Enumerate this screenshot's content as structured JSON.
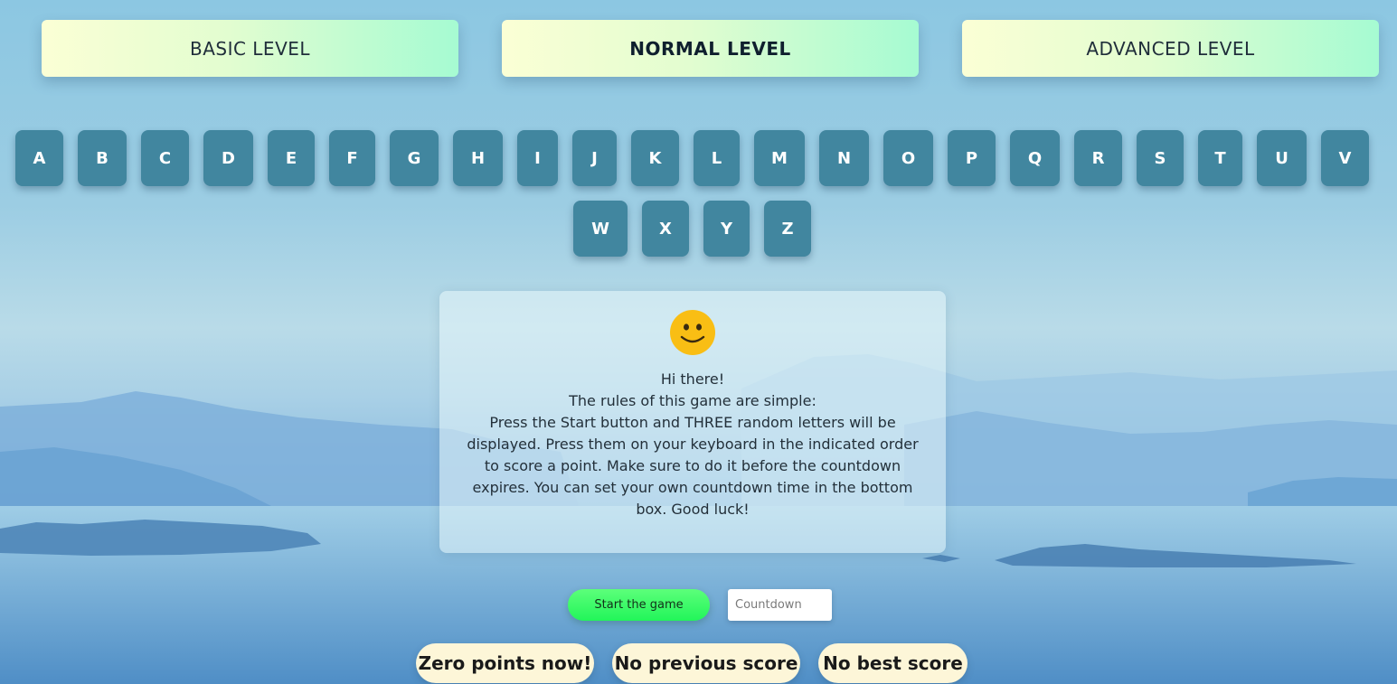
{
  "levels": [
    {
      "label": "BASIC LEVEL",
      "active": false
    },
    {
      "label": "NORMAL LEVEL",
      "active": true
    },
    {
      "label": "ADVANCED LEVEL",
      "active": false
    }
  ],
  "keyboard": {
    "letters": [
      "A",
      "B",
      "C",
      "D",
      "E",
      "F",
      "G",
      "H",
      "I",
      "J",
      "K",
      "L",
      "M",
      "N",
      "O",
      "P",
      "Q",
      "R",
      "S",
      "T",
      "U",
      "V",
      "W",
      "X",
      "Y",
      "Z"
    ]
  },
  "rules": {
    "emoji_icon": "smiley-face-icon",
    "greeting": "Hi there!",
    "intro": "The rules of this game are simple:",
    "body": "Press the Start button and THREE random letters will be displayed. Press them on your keyboard in the indicated order to score a point. Make sure to do it before the countdown expires. You can set your own countdown time in the bottom box. Good luck!"
  },
  "controls": {
    "start_label": "Start the game",
    "countdown_placeholder": "Countdown",
    "countdown_value": ""
  },
  "scores": {
    "current": "Zero points now!",
    "previous": "No previous score",
    "best": "No best score"
  },
  "colors": {
    "key_bg": "#41869f",
    "start_button": "#2af55c",
    "score_pill": "#fdf6d8"
  }
}
